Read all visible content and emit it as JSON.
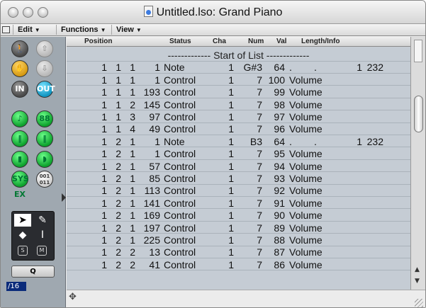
{
  "window": {
    "title": "Untitled.lso: Grand Piano"
  },
  "menus": [
    {
      "label": "Edit"
    },
    {
      "label": "Functions"
    },
    {
      "label": "View"
    }
  ],
  "columns": [
    "Position",
    "Status",
    "Cha",
    "Num",
    "Val",
    "Length/Info"
  ],
  "start_label": "------------- Start of List -------------",
  "rows": [
    {
      "p1": "1",
      "p2": "1",
      "p3": "1",
      "p4": "1",
      "status": "Note",
      "cha": "1",
      "num": "G#3",
      "val": "64",
      "info1": ".",
      "info2": ".",
      "info3": "1",
      "info4": "232"
    },
    {
      "p1": "1",
      "p2": "1",
      "p3": "1",
      "p4": "1",
      "status": "Control",
      "cha": "1",
      "num": "7",
      "val": "100",
      "info1": "Volume",
      "info2": "",
      "info3": "",
      "info4": ""
    },
    {
      "p1": "1",
      "p2": "1",
      "p3": "1",
      "p4": "193",
      "status": "Control",
      "cha": "1",
      "num": "7",
      "val": "99",
      "info1": "Volume",
      "info2": "",
      "info3": "",
      "info4": ""
    },
    {
      "p1": "1",
      "p2": "1",
      "p3": "2",
      "p4": "145",
      "status": "Control",
      "cha": "1",
      "num": "7",
      "val": "98",
      "info1": "Volume",
      "info2": "",
      "info3": "",
      "info4": ""
    },
    {
      "p1": "1",
      "p2": "1",
      "p3": "3",
      "p4": "97",
      "status": "Control",
      "cha": "1",
      "num": "7",
      "val": "97",
      "info1": "Volume",
      "info2": "",
      "info3": "",
      "info4": ""
    },
    {
      "p1": "1",
      "p2": "1",
      "p3": "4",
      "p4": "49",
      "status": "Control",
      "cha": "1",
      "num": "7",
      "val": "96",
      "info1": "Volume",
      "info2": "",
      "info3": "",
      "info4": ""
    },
    {
      "p1": "1",
      "p2": "2",
      "p3": "1",
      "p4": "1",
      "status": "Note",
      "cha": "1",
      "num": "B3",
      "val": "64",
      "info1": ".",
      "info2": ".",
      "info3": "1",
      "info4": "232"
    },
    {
      "p1": "1",
      "p2": "2",
      "p3": "1",
      "p4": "1",
      "status": "Control",
      "cha": "1",
      "num": "7",
      "val": "95",
      "info1": "Volume",
      "info2": "",
      "info3": "",
      "info4": ""
    },
    {
      "p1": "1",
      "p2": "2",
      "p3": "1",
      "p4": "57",
      "status": "Control",
      "cha": "1",
      "num": "7",
      "val": "94",
      "info1": "Volume",
      "info2": "",
      "info3": "",
      "info4": ""
    },
    {
      "p1": "1",
      "p2": "2",
      "p3": "1",
      "p4": "85",
      "status": "Control",
      "cha": "1",
      "num": "7",
      "val": "93",
      "info1": "Volume",
      "info2": "",
      "info3": "",
      "info4": ""
    },
    {
      "p1": "1",
      "p2": "2",
      "p3": "1",
      "p4": "113",
      "status": "Control",
      "cha": "1",
      "num": "7",
      "val": "92",
      "info1": "Volume",
      "info2": "",
      "info3": "",
      "info4": ""
    },
    {
      "p1": "1",
      "p2": "2",
      "p3": "1",
      "p4": "141",
      "status": "Control",
      "cha": "1",
      "num": "7",
      "val": "91",
      "info1": "Volume",
      "info2": "",
      "info3": "",
      "info4": ""
    },
    {
      "p1": "1",
      "p2": "2",
      "p3": "1",
      "p4": "169",
      "status": "Control",
      "cha": "1",
      "num": "7",
      "val": "90",
      "info1": "Volume",
      "info2": "",
      "info3": "",
      "info4": ""
    },
    {
      "p1": "1",
      "p2": "2",
      "p3": "1",
      "p4": "197",
      "status": "Control",
      "cha": "1",
      "num": "7",
      "val": "89",
      "info1": "Volume",
      "info2": "",
      "info3": "",
      "info4": ""
    },
    {
      "p1": "1",
      "p2": "2",
      "p3": "1",
      "p4": "225",
      "status": "Control",
      "cha": "1",
      "num": "7",
      "val": "88",
      "info1": "Volume",
      "info2": "",
      "info3": "",
      "info4": ""
    },
    {
      "p1": "1",
      "p2": "2",
      "p3": "2",
      "p4": "13",
      "status": "Control",
      "cha": "1",
      "num": "7",
      "val": "87",
      "info1": "Volume",
      "info2": "",
      "info3": "",
      "info4": ""
    },
    {
      "p1": "1",
      "p2": "2",
      "p3": "2",
      "p4": "41",
      "status": "Control",
      "cha": "1",
      "num": "7",
      "val": "86",
      "info1": "Volume",
      "info2": "",
      "info3": "",
      "info4": ""
    }
  ],
  "toolbox": {
    "buttons": [
      {
        "icon": "walking-man-icon",
        "glyph": "🚶",
        "style": "tb-gray"
      },
      {
        "icon": "up-arrow-icon",
        "glyph": "⇧",
        "style": "tb-dim"
      },
      {
        "icon": "hand-orange-icon",
        "glyph": "✋",
        "style": "tb-orange"
      },
      {
        "icon": "down-arrow-icon",
        "glyph": "⇩",
        "style": "tb-dim"
      },
      {
        "icon": "in-keyboard-icon",
        "glyph": "IN",
        "style": "tb-gray"
      },
      {
        "icon": "out-keyboard-icon",
        "glyph": "OUT",
        "style": "tb-cyan"
      },
      {
        "icon": "note-filter-icon",
        "glyph": "♪",
        "style": "tb-green"
      },
      {
        "icon": "counter-filter-icon",
        "glyph": "88",
        "style": "tb-green"
      },
      {
        "icon": "fader-filter-icon",
        "glyph": "‖",
        "style": "tb-green"
      },
      {
        "icon": "fader-alt-filter-icon",
        "glyph": "‖",
        "style": "tb-green"
      },
      {
        "icon": "aftertouch-filter-icon",
        "glyph": "▮",
        "style": "tb-green"
      },
      {
        "icon": "pitchbend-filter-icon",
        "glyph": "◗",
        "style": "tb-green"
      },
      {
        "icon": "sysex-filter-icon",
        "glyph": "SYS EX",
        "style": "tb-green"
      },
      {
        "icon": "binary-filter-icon",
        "glyph": "001 011",
        "style": "tb-white"
      }
    ],
    "q_label": "Q",
    "division": "/16"
  }
}
